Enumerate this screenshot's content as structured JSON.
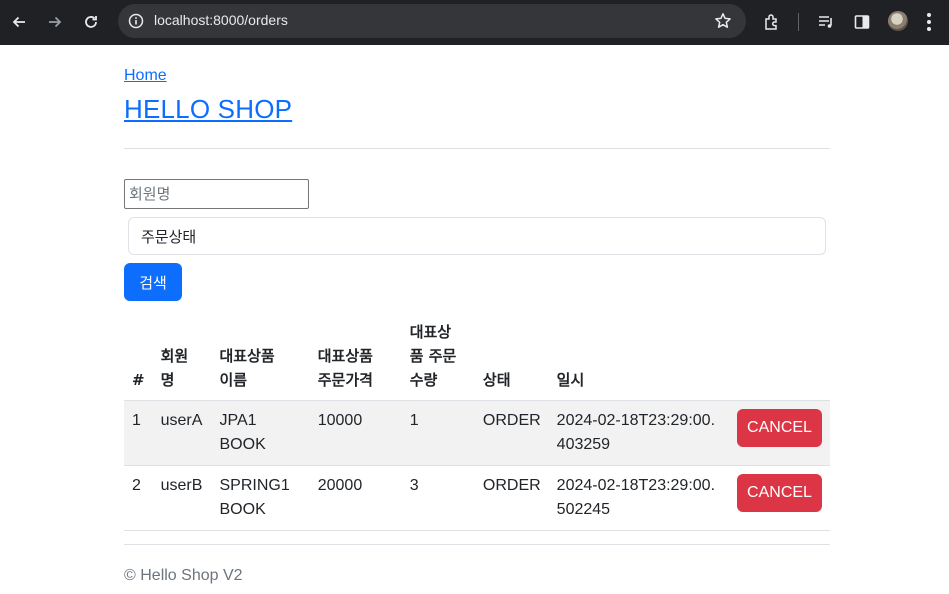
{
  "browser": {
    "url": "localhost:8000/orders",
    "icons": [
      "back-arrow-icon",
      "forward-arrow-icon",
      "reload-icon",
      "site-info-icon",
      "bookmark-star-icon",
      "extensions-icon",
      "media-control-icon",
      "side-panel-icon",
      "profile-avatar",
      "kebab-menu-icon"
    ]
  },
  "header": {
    "home_link": "Home",
    "title": "HELLO SHOP"
  },
  "search": {
    "member_placeholder": "회원명",
    "status_select": "주문상태",
    "button": "검색"
  },
  "table": {
    "headers": {
      "num": "#",
      "member": "회원\n명",
      "item_name": "대표상품\n이름",
      "item_price": "대표상품\n주문가격",
      "item_qty": "대표상\n품 주문\n수량",
      "status": "상태",
      "date": "일시"
    },
    "rows": [
      {
        "num": "1",
        "member": "userA",
        "item_name": "JPA1 BOOK",
        "price": "10000",
        "qty": "1",
        "status": "ORDER",
        "date": "2024-02-18T23:29:00.403259",
        "action": "CANCEL"
      },
      {
        "num": "2",
        "member": "userB",
        "item_name": "SPRING1 BOOK",
        "price": "20000",
        "qty": "3",
        "status": "ORDER",
        "date": "2024-02-18T23:29:00.502245",
        "action": "CANCEL"
      }
    ]
  },
  "footer": {
    "text": "© Hello Shop V2"
  },
  "colors": {
    "primary": "#0d6efd",
    "danger": "#dc3545",
    "chrome_bg": "#202124",
    "striped_row": "#f2f2f2"
  }
}
